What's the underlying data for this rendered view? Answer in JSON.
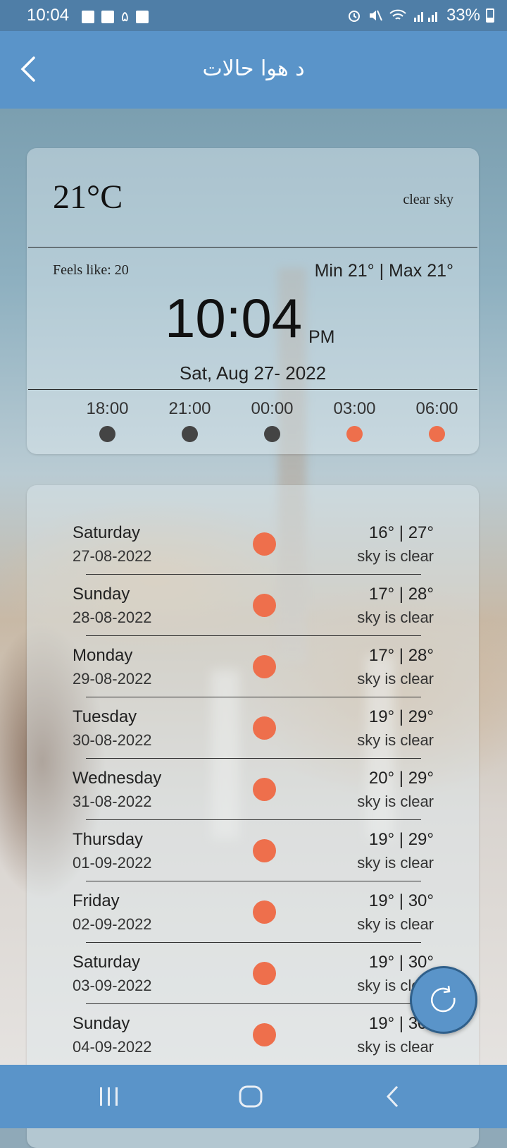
{
  "status_bar": {
    "time": "10:04",
    "notification_digit": "۵",
    "battery": "33%"
  },
  "header": {
    "title": "د هوا حالات"
  },
  "current": {
    "temperature": "21°C",
    "condition": "clear sky",
    "feels_like": "Feels like: 20",
    "min_max": "Min 21° | Max 21°",
    "clock": "10:04",
    "ampm": "PM",
    "date": "Sat, Aug 27- 2022",
    "hourly": [
      {
        "time": "18:00",
        "icon": "night-dot-icon",
        "color": "#444444"
      },
      {
        "time": "21:00",
        "icon": "night-dot-icon",
        "color": "#444444"
      },
      {
        "time": "00:00",
        "icon": "night-dot-icon",
        "color": "#444444"
      },
      {
        "time": "03:00",
        "icon": "sun-icon",
        "color": "#ee6f4c"
      },
      {
        "time": "06:00",
        "icon": "sun-icon",
        "color": "#ee6f4c"
      }
    ]
  },
  "forecast": [
    {
      "day": "Saturday",
      "date": "27-08-2022",
      "temps": "16° | 27°",
      "desc": "sky is clear"
    },
    {
      "day": "Sunday",
      "date": "28-08-2022",
      "temps": "17° | 28°",
      "desc": "sky is clear"
    },
    {
      "day": "Monday",
      "date": "29-08-2022",
      "temps": "17° | 28°",
      "desc": "sky is clear"
    },
    {
      "day": "Tuesday",
      "date": "30-08-2022",
      "temps": "19° | 29°",
      "desc": "sky is clear"
    },
    {
      "day": "Wednesday",
      "date": "31-08-2022",
      "temps": "20° | 29°",
      "desc": "sky is clear"
    },
    {
      "day": "Thursday",
      "date": "01-09-2022",
      "temps": "19° | 29°",
      "desc": "sky is clear"
    },
    {
      "day": "Friday",
      "date": "02-09-2022",
      "temps": "19° | 30°",
      "desc": "sky is clear"
    },
    {
      "day": "Saturday",
      "date": "03-09-2022",
      "temps": "19° | 30°",
      "desc": "sky is clear"
    },
    {
      "day": "Sunday",
      "date": "04-09-2022",
      "temps": "19° | 30°",
      "desc": "sky is clear"
    }
  ],
  "colors": {
    "app_bar": "#5a94c9",
    "status_bar": "#4f7ea7",
    "sun": "#ee6f4c",
    "night": "#444444"
  }
}
